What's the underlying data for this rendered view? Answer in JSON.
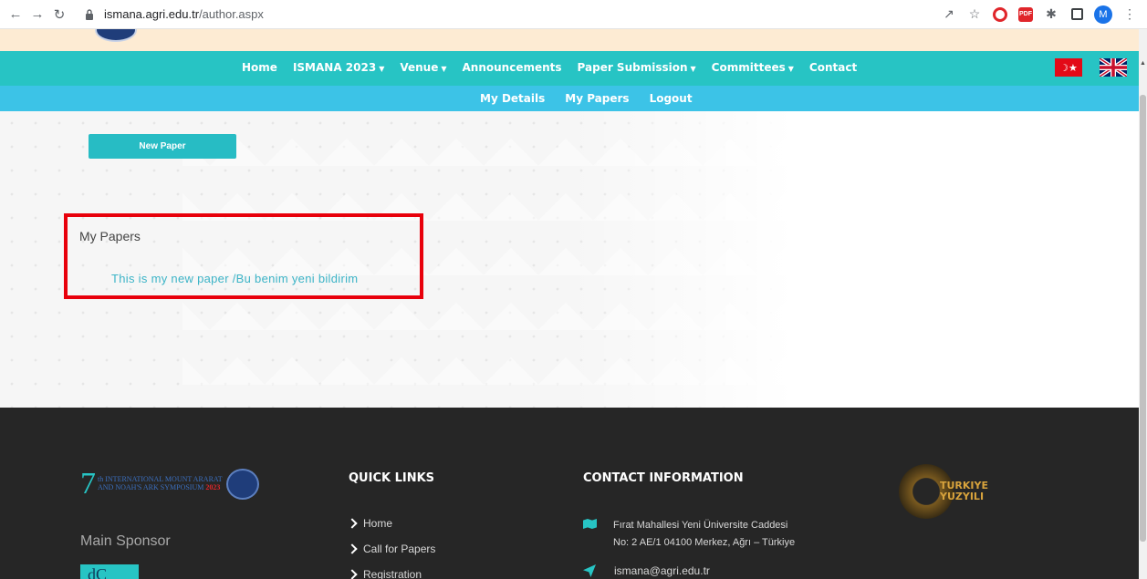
{
  "browser": {
    "url_host": "ismana.agri.edu.tr",
    "url_path": "/author.aspx",
    "profile_initial": "M"
  },
  "main_nav": {
    "items": [
      {
        "label": "Home",
        "dropdown": false
      },
      {
        "label": "ISMANA 2023",
        "dropdown": true
      },
      {
        "label": "Venue",
        "dropdown": true
      },
      {
        "label": "Announcements",
        "dropdown": false
      },
      {
        "label": "Paper Submission",
        "dropdown": true
      },
      {
        "label": "Committees",
        "dropdown": true
      },
      {
        "label": "Contact",
        "dropdown": false
      }
    ]
  },
  "sub_nav": {
    "items": [
      "My Details",
      "My Papers",
      "Logout"
    ]
  },
  "content": {
    "new_paper_label": "New Paper",
    "papers_heading": "My Papers",
    "paper_link": "This is my new paper /Bu benim yeni bildirim"
  },
  "footer": {
    "logo_number": "7",
    "logo_sup": "th",
    "logo_line1": "INTERNATIONAL MOUNT ARARAT",
    "logo_line2": "AND NOAH'S ARK SYMPOSIUM",
    "logo_year": "2023",
    "sponsor_label": "Main Sponsor",
    "sponsor_logo_text": "dC",
    "quick_links_title": "QUICK LINKS",
    "quick_links": [
      "Home",
      "Call for Papers",
      "Registration"
    ],
    "contact_title": "CONTACT INFORMATION",
    "address_line1": "Fırat Mahallesi Yeni Üniversite Caddesi",
    "address_line2": "No: 2 AE/1 04100 Merkez, Ağrı – Türkiye",
    "email": "ismana@agri.edu.tr",
    "turkiye_line1": "TURKIYE",
    "turkiye_line2": "YUZYILI"
  },
  "colors": {
    "main_nav_bg": "#27c4c4",
    "sub_nav_bg": "#3cc3e7",
    "highlight_border": "#e8000b",
    "link": "#3cb4c7",
    "footer_bg": "#262626"
  }
}
